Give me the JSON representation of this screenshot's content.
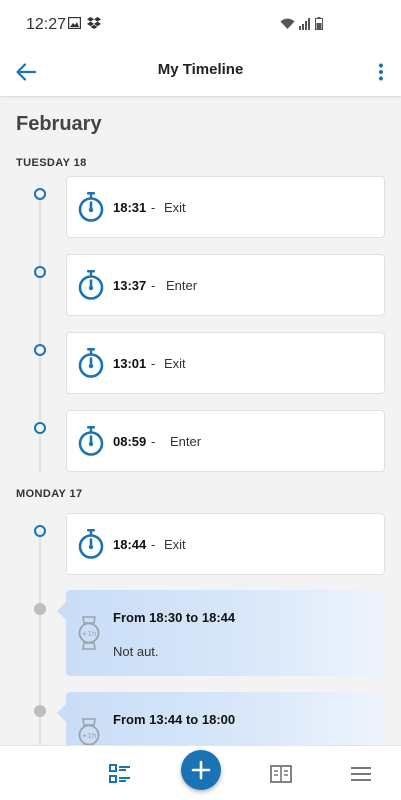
{
  "status_bar": {
    "time": "12:27"
  },
  "app_bar": {
    "title": "My Timeline"
  },
  "month": "February",
  "days": [
    {
      "label": "TUESDAY 18",
      "events": [
        {
          "time": "18:31",
          "separator": "-",
          "action": "Exit"
        },
        {
          "time": "13:37",
          "separator": "-",
          "action": "Enter"
        },
        {
          "time": "13:01",
          "separator": "-",
          "action": "Exit"
        },
        {
          "time": "08:59",
          "separator": "-",
          "action": "Enter"
        }
      ]
    },
    {
      "label": "MONDAY 17",
      "events": [
        {
          "time": "18:44",
          "separator": "-",
          "action": "Exit"
        }
      ],
      "absences": [
        {
          "range": "From 18:30 to 18:44",
          "status": "Not aut."
        },
        {
          "range": "From 13:44 to 18:00"
        }
      ]
    }
  ],
  "icons": {
    "back": "arrow-back-icon",
    "more": "more-vert-icon",
    "event": "stopwatch-icon",
    "absence": "watch-icon",
    "nav_timeline": "timeline-list-icon",
    "nav_add": "plus-icon",
    "nav_reports": "report-icon",
    "nav_menu": "hamburger-menu-icon"
  },
  "colors": {
    "accent": "#1a73b5",
    "absence_card": "#c9ddf6",
    "dot_inactive": "#bdbdbd"
  }
}
